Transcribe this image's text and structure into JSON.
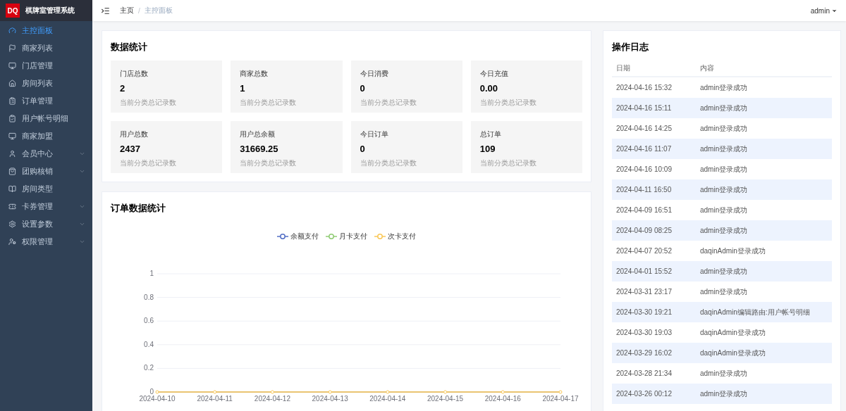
{
  "app": {
    "logo": "DQ",
    "title": "棋牌室管理系统"
  },
  "sidebar": {
    "items": [
      {
        "label": "主控面板",
        "selected": true,
        "expandable": false
      },
      {
        "label": "商家列表",
        "selected": false,
        "expandable": false
      },
      {
        "label": "门店管理",
        "selected": false,
        "expandable": false
      },
      {
        "label": "房间列表",
        "selected": false,
        "expandable": false
      },
      {
        "label": "订单管理",
        "selected": false,
        "expandable": false
      },
      {
        "label": "用户帐号明细",
        "selected": false,
        "expandable": false
      },
      {
        "label": "商家加盟",
        "selected": false,
        "expandable": false
      },
      {
        "label": "会员中心",
        "selected": false,
        "expandable": true
      },
      {
        "label": "团购核销",
        "selected": false,
        "expandable": true
      },
      {
        "label": "房间类型",
        "selected": false,
        "expandable": false
      },
      {
        "label": "卡券管理",
        "selected": false,
        "expandable": true
      },
      {
        "label": "设置参数",
        "selected": false,
        "expandable": true
      },
      {
        "label": "权限管理",
        "selected": false,
        "expandable": true
      }
    ]
  },
  "header": {
    "breadcrumb": [
      {
        "label": "主页",
        "selected": false
      },
      {
        "label": "主控面板",
        "selected": true
      }
    ],
    "separator": "/",
    "user": "admin"
  },
  "stats": {
    "title": "数据统计",
    "cards": [
      {
        "label": "门店总数",
        "value": "2",
        "note": "当前分类总记录数"
      },
      {
        "label": "商家总数",
        "value": "1",
        "note": "当前分类总记录数"
      },
      {
        "label": "今日消费",
        "value": "0",
        "note": "当前分类总记录数"
      },
      {
        "label": "今日充值",
        "value": "0.00",
        "note": "当前分类总记录数"
      },
      {
        "label": "用户总数",
        "value": "2437",
        "note": "当前分类总记录数"
      },
      {
        "label": "用户总余额",
        "value": "31669.25",
        "note": "当前分类总记录数"
      },
      {
        "label": "今日订单",
        "value": "0",
        "note": "当前分类总记录数"
      },
      {
        "label": "总订单",
        "value": "109",
        "note": "当前分类总记录数"
      }
    ]
  },
  "orders_chart": {
    "title": "订单数据统计",
    "chart_data": {
      "type": "line",
      "categories": [
        "2024-04-10",
        "2024-04-11",
        "2024-04-12",
        "2024-04-13",
        "2024-04-14",
        "2024-04-15",
        "2024-04-16",
        "2024-04-17"
      ],
      "series": [
        {
          "name": "余额支付",
          "color": "#5470c6",
          "marker": true,
          "values": [
            null,
            null,
            null,
            null,
            null,
            null,
            null,
            null
          ]
        },
        {
          "name": "月卡支付",
          "color": "#91cc75",
          "marker": true,
          "values": [
            null,
            null,
            null,
            null,
            null,
            null,
            null,
            null
          ]
        },
        {
          "name": "次卡支付",
          "color": "#fac858",
          "marker": true,
          "values": [
            0,
            0,
            0,
            0,
            0,
            0,
            0,
            0
          ]
        }
      ],
      "grid": true,
      "ylim": [
        0,
        1
      ],
      "yticks": [
        0,
        0.2,
        0.4,
        0.6,
        0.8,
        1
      ]
    }
  },
  "log": {
    "title": "操作日志",
    "columns": [
      "日期",
      "内容"
    ],
    "rows": [
      [
        "2024-04-16 15:32",
        "admin登录成功"
      ],
      [
        "2024-04-16 15:11",
        "admin登录成功"
      ],
      [
        "2024-04-16 14:25",
        "admin登录成功"
      ],
      [
        "2024-04-16 11:07",
        "admin登录成功"
      ],
      [
        "2024-04-16 10:09",
        "admin登录成功"
      ],
      [
        "2024-04-11 16:50",
        "admin登录成功"
      ],
      [
        "2024-04-09 16:51",
        "admin登录成功"
      ],
      [
        "2024-04-09 08:25",
        "admin登录成功"
      ],
      [
        "2024-04-07 20:52",
        "daqinAdmin登录成功"
      ],
      [
        "2024-04-01 15:52",
        "admin登录成功"
      ],
      [
        "2024-03-31 23:17",
        "admin登录成功"
      ],
      [
        "2024-03-30 19:21",
        "daqinAdmin编辑路由:用户帐号明细"
      ],
      [
        "2024-03-30 19:03",
        "daqinAdmin登录成功"
      ],
      [
        "2024-03-29 16:02",
        "daqinAdmin登录成功"
      ],
      [
        "2024-03-28 21:34",
        "admin登录成功"
      ],
      [
        "2024-03-26 00:12",
        "admin登录成功"
      ]
    ]
  }
}
